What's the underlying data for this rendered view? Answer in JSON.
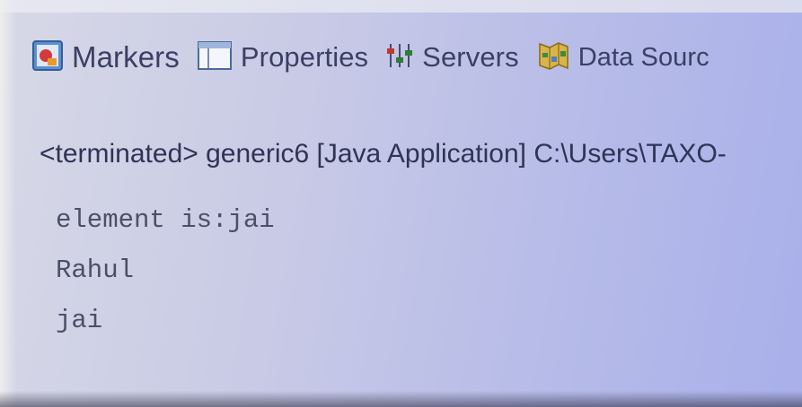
{
  "tabs": [
    {
      "id": "markers",
      "label": "Markers",
      "icon": "markers-icon"
    },
    {
      "id": "properties",
      "label": "Properties",
      "icon": "properties-icon"
    },
    {
      "id": "servers",
      "label": "Servers",
      "icon": "servers-icon"
    },
    {
      "id": "datasource",
      "label": "Data Sourc",
      "icon": "data-source-icon"
    }
  ],
  "console": {
    "header": "<terminated> generic6 [Java Application] C:\\Users\\TAXO-",
    "lines": [
      "element is:jai",
      "Rahul",
      "jai"
    ]
  },
  "colors": {
    "background": "#c9cbe6",
    "text": "#3a4063",
    "console_text": "#4b5068"
  }
}
